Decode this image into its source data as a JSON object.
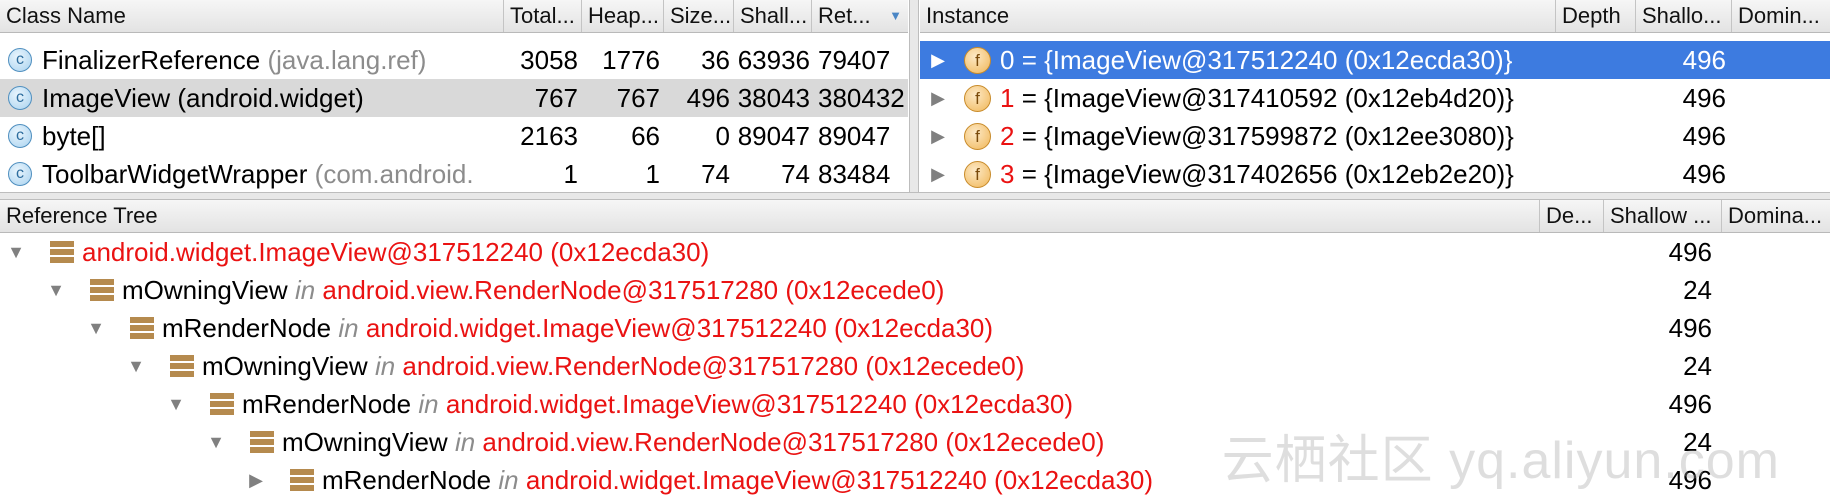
{
  "class_table": {
    "headers": {
      "class_name": "Class Name",
      "total": "Total...",
      "heap": "Heap...",
      "size": "Size...",
      "shallow": "Shall...",
      "retained": "Ret..."
    },
    "rows": [
      {
        "name": "FinalizerReference",
        "pkg": "(java.lang.ref)",
        "total": "3058",
        "heap": "1776",
        "size": "36",
        "shallow": "63936",
        "retained": "79407"
      },
      {
        "name": "ImageView",
        "pkg": "(android.widget)",
        "total": "767",
        "heap": "767",
        "size": "496",
        "shallow": "38043",
        "retained": "380432"
      },
      {
        "name": "byte[]",
        "pkg": "",
        "total": "2163",
        "heap": "66",
        "size": "0",
        "shallow": "89047",
        "retained": "89047"
      },
      {
        "name": "ToolbarWidgetWrapper",
        "pkg": "(com.android.",
        "total": "1",
        "heap": "1",
        "size": "74",
        "shallow": "74",
        "retained": "83484"
      }
    ]
  },
  "instance_table": {
    "headers": {
      "instance": "Instance",
      "depth": "Depth",
      "shallow": "Shallo...",
      "dominator": "Domin..."
    },
    "rows": [
      {
        "index": "0",
        "text": "= {ImageView@317512240 (0x12ecda30)}",
        "shallow": "496"
      },
      {
        "index": "1",
        "text": "= {ImageView@317410592 (0x12eb4d20)}",
        "shallow": "496"
      },
      {
        "index": "2",
        "text": "= {ImageView@317599872 (0x12ee3080)}",
        "shallow": "496"
      },
      {
        "index": "3",
        "text": "= {ImageView@317402656 (0x12eb2e20)}",
        "shallow": "496"
      }
    ]
  },
  "reference_tree": {
    "headers": {
      "name": "Reference Tree",
      "depth": "De...",
      "shallow": "Shallow ...",
      "dominator": "Domina..."
    },
    "rows": [
      {
        "field": "",
        "in_word": "",
        "target": "android.widget.ImageView@317512240 (0x12ecda30)",
        "shallow": "496"
      },
      {
        "field": "mOwningView",
        "in_word": "in",
        "target": "android.view.RenderNode@317517280 (0x12ecede0)",
        "shallow": "24"
      },
      {
        "field": "mRenderNode",
        "in_word": "in",
        "target": "android.widget.ImageView@317512240 (0x12ecda30)",
        "shallow": "496"
      },
      {
        "field": "mOwningView",
        "in_word": "in",
        "target": "android.view.RenderNode@317517280 (0x12ecede0)",
        "shallow": "24"
      },
      {
        "field": "mRenderNode",
        "in_word": "in",
        "target": "android.widget.ImageView@317512240 (0x12ecda30)",
        "shallow": "496"
      },
      {
        "field": "mOwningView",
        "in_word": "in",
        "target": "android.view.RenderNode@317517280 (0x12ecede0)",
        "shallow": "24"
      },
      {
        "field": "mRenderNode",
        "in_word": "in",
        "target": "android.widget.ImageView@317512240 (0x12ecda30)",
        "shallow": "496"
      }
    ]
  },
  "icons": {
    "class_icon": "class-c-icon",
    "field_icon": "field-f-icon",
    "expand_icon": "expand-triangle-icon",
    "tree_node_icon": "stack-icon"
  },
  "glyphs": {
    "class_letter": "c",
    "field_letter": "f",
    "sort_desc": "▼",
    "expanded": "▼",
    "collapsed": "▶"
  },
  "colors": {
    "selection": "#3d7be0",
    "reference_red": "#ea1212"
  },
  "watermark": "云栖社区 yq.aliyun.com"
}
